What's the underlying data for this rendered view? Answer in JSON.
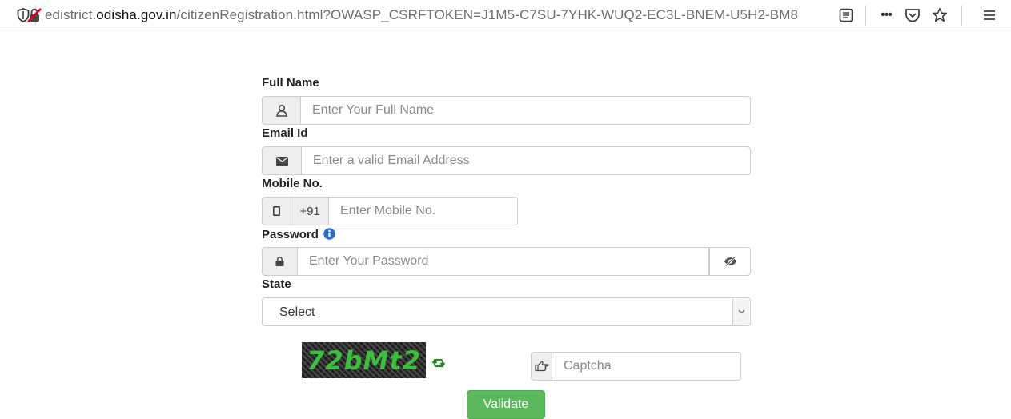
{
  "browser": {
    "url_prefix": "edistrict.",
    "url_domain": "odisha.gov.in",
    "url_suffix": "/citizenRegistration.html?OWASP_CSRFTOKEN=J1M5-C7SU-7YHK-WUQ2-EC3L-BNEM-U5H2-BM8",
    "more_label": "•••"
  },
  "form": {
    "full_name": {
      "label": "Full Name",
      "placeholder": "Enter Your Full Name",
      "value": ""
    },
    "email": {
      "label": "Email Id",
      "placeholder": "Enter a valid Email Address",
      "value": ""
    },
    "mobile": {
      "label": "Mobile No.",
      "prefix": "+91",
      "placeholder": "Enter Mobile No.",
      "value": ""
    },
    "password": {
      "label": "Password",
      "placeholder": "Enter Your Password",
      "value": ""
    },
    "state": {
      "label": "State",
      "selected": "Select"
    },
    "captcha": {
      "image_text": "72bMt2",
      "placeholder": "Captcha",
      "value": ""
    },
    "validate_label": "Validate"
  },
  "colors": {
    "validate_bg": "#5cb85c",
    "captcha_text": "#3cbf3c",
    "info_icon": "#2b6cc4"
  },
  "icons": [
    "shield-icon",
    "insecure-connection-icon",
    "reader-view-icon",
    "more-actions-icon",
    "pocket-icon",
    "bookmark-star-icon",
    "menu-icon",
    "user-icon",
    "envelope-icon",
    "mobile-icon",
    "info-icon",
    "lock-icon",
    "eye-slash-icon",
    "chevron-down-icon",
    "refresh-icon",
    "hand-pointer-icon"
  ]
}
